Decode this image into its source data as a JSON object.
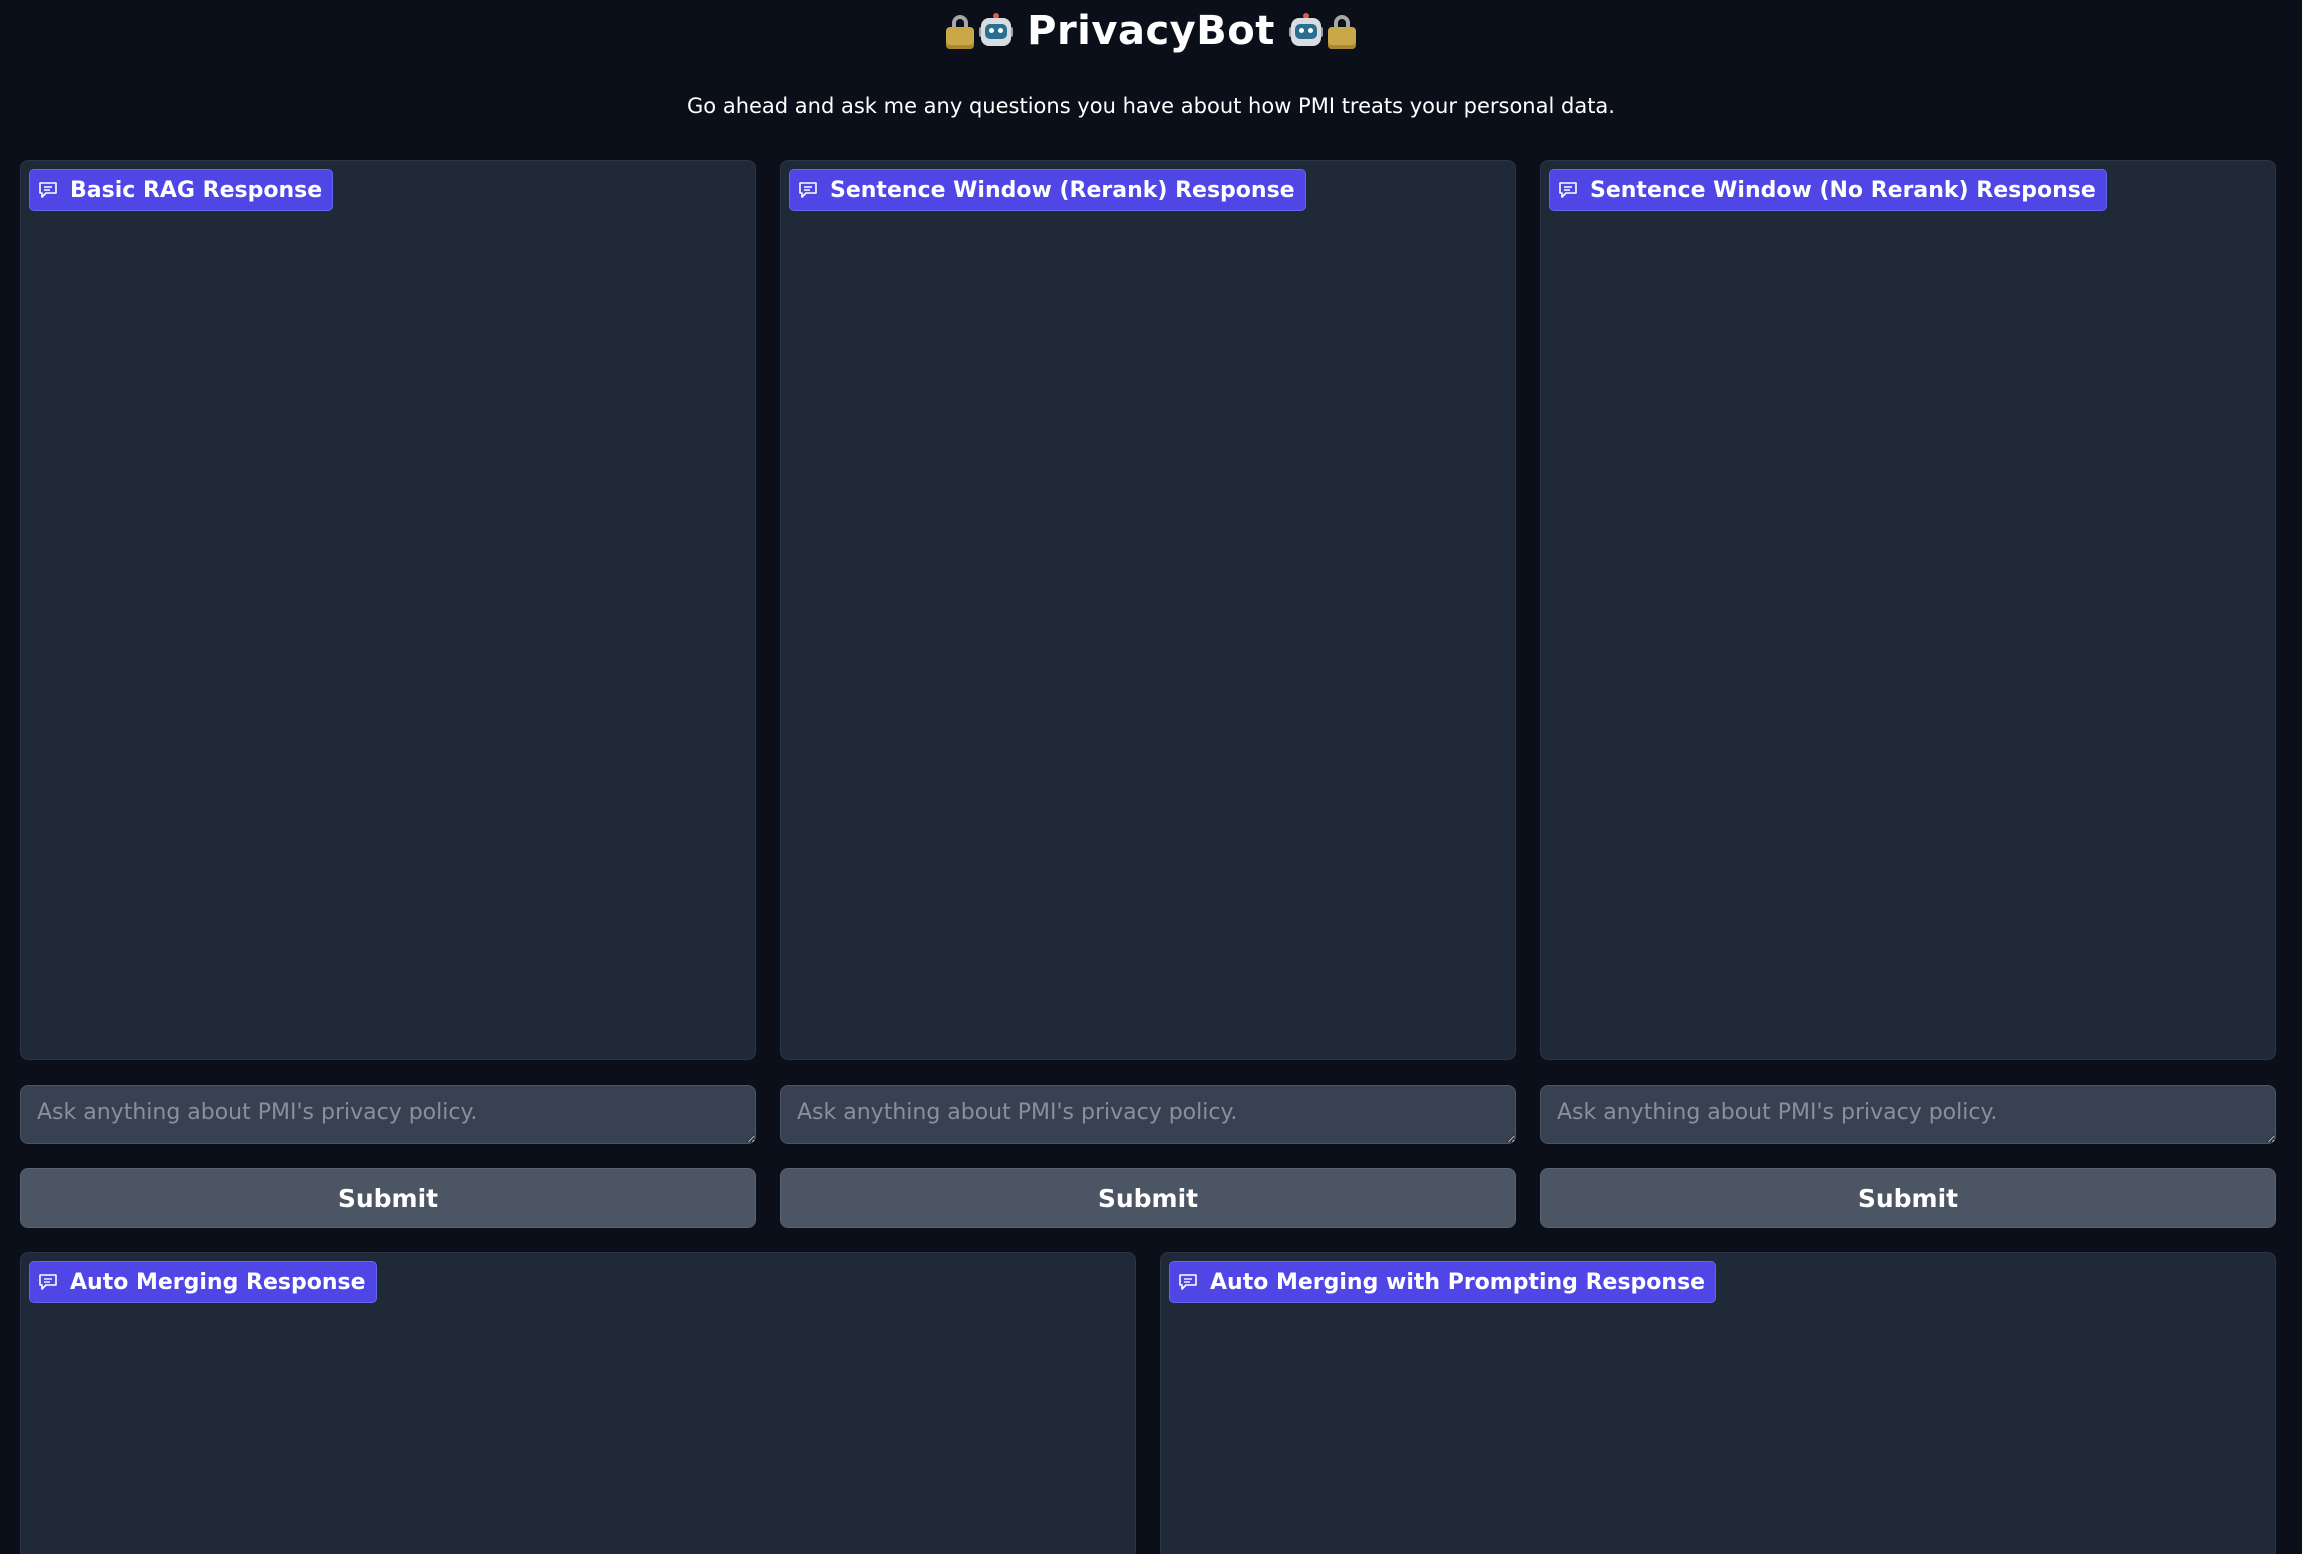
{
  "header": {
    "title": "PrivacyBot",
    "left_icons": [
      "lock-icon",
      "robot-icon"
    ],
    "right_icons": [
      "robot-icon",
      "lock-icon"
    ]
  },
  "subtitle": "Go ahead and ask me any questions you have about how PMI treats your personal data.",
  "panels": [
    {
      "label": "Basic RAG Response",
      "input_placeholder": "Ask anything about PMI's privacy policy.",
      "input_value": "",
      "submit_label": "Submit"
    },
    {
      "label": "Sentence Window (Rerank) Response",
      "input_placeholder": "Ask anything about PMI's privacy policy.",
      "input_value": "",
      "submit_label": "Submit"
    },
    {
      "label": "Sentence Window (No Rerank) Response",
      "input_placeholder": "Ask anything about PMI's privacy policy.",
      "input_value": "",
      "submit_label": "Submit"
    },
    {
      "label": "Auto Merging Response"
    },
    {
      "label": "Auto Merging with Prompting Response"
    }
  ],
  "colors": {
    "background": "#0b0f19",
    "panel": "#1f2937",
    "label_accent": "#4f46e5",
    "input": "#374151",
    "button": "#4b5563"
  }
}
